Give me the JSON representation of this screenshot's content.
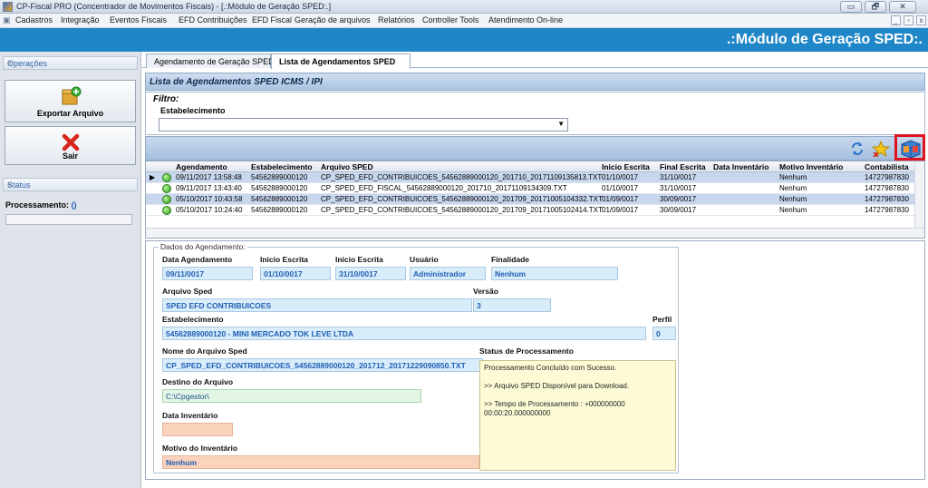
{
  "window": {
    "title": "CP-Fiscal PRO (Concentrador de Movimentos Fiscais) - [.:Módulo de Geração SPED:.]",
    "controls": [
      "▭",
      "🗗",
      "✕"
    ],
    "mdi_controls": [
      "_",
      "▫",
      "x"
    ]
  },
  "menu": [
    "Cadastros",
    "Integração",
    "Eventos Fiscais",
    "EFD Contribuições",
    "EFD Fiscal",
    "Geração de arquivos",
    "Relatórios",
    "Controller Tools",
    "Atendimento On-line"
  ],
  "banner": ".:Módulo de Geração SPED:.",
  "sidebar": {
    "operacoes_title": "Operações",
    "export_label": "Exportar Arquivo",
    "sair_label": "Sair",
    "status_title": "Status",
    "processamento_label": "Processamento:",
    "processamento_value": "()"
  },
  "tabs": [
    "Agendamento de Geração SPED",
    "Lista de Agendamentos SPED"
  ],
  "list": {
    "header": "Lista de Agendamentos SPED ICMS / IPI",
    "filtro_label": "Filtro:",
    "estabelecimento_label": "Estabelecimento",
    "estabelecimento_value": ""
  },
  "grid": {
    "columns": [
      "Agendamento",
      "Estabelecimento",
      "Arquivo SPED",
      "Inicio Escrita",
      "Final Escrita",
      "Data Inventário",
      "Motivo Inventário",
      "Contabilista"
    ],
    "rows": [
      [
        "09/11/2017 13:58:48",
        "54562889000120",
        "CP_SPED_EFD_CONTRIBUICOES_54562889000120_201710_20171109135813.TXT",
        "01/10/0017",
        "31/10/0017",
        "",
        "Nenhum",
        "14727987830"
      ],
      [
        "09/11/2017 13:43:40",
        "54562889000120",
        "CP_SPED_EFD_FISCAL_54562889000120_201710_20171109134309.TXT",
        "01/10/0017",
        "31/10/0017",
        "",
        "Nenhum",
        "14727987830"
      ],
      [
        "05/10/2017 10:43:58",
        "54562889000120",
        "CP_SPED_EFD_CONTRIBUICOES_54562889000120_201709_20171005104332.TXT",
        "01/09/0017",
        "30/09/0017",
        "",
        "Nenhum",
        "14727987830"
      ],
      [
        "05/10/2017 10:24:40",
        "54562889000120",
        "CP_SPED_EFD_CONTRIBUICOES_54562889000120_201709_20171005102414.TXT",
        "01/09/0017",
        "30/09/0017",
        "",
        "Nenhum",
        "14727987830"
      ]
    ]
  },
  "details": {
    "group_title": "Dados do Agendamento:",
    "data_agendamento_label": "Data Agendamento",
    "data_agendamento": "09/11/0017",
    "inicio_escrita_label": "Inicio Escrita",
    "inicio_escrita": "01/10/0017",
    "final_escrita_label": "Inicio Escrita",
    "final_escrita": "31/10/0017",
    "usuario_label": "Usuário",
    "usuario": "Administrador",
    "finalidade_label": "Finalidade",
    "finalidade": "Nenhum",
    "arquivo_sped_label": "Arquivo Sped",
    "arquivo_sped": "SPED EFD CONTRIBUICOES",
    "versao_label": "Versão",
    "versao": "3",
    "estabelecimento_label": "Estabelecimento",
    "estabelecimento": "54562889000120 - MINI MERCADO TOK LEVE LTDA",
    "perfil_label": "Perfil",
    "perfil": "0",
    "nome_arquivo_label": "Nome do Arquivo Sped",
    "nome_arquivo": "CP_SPED_EFD_CONTRIBUICOES_54562889000120_201712_20171229090850.TXT",
    "destino_label": "Destino do Arquivo",
    "destino": "C:\\Cpgestor\\",
    "data_inventario_label": "Data Inventário",
    "data_inventario": "",
    "motivo_label": "Motivo do Inventário",
    "motivo": "Nenhum",
    "status_label": "Status de Processamento",
    "status_text": "Processamento Concluído com Sucesso.\n\n>> Arquivo SPED Disponível para Download.\n\n>> Tempo de Processamento : +000000000 00:00:20.000000000"
  },
  "colors": {
    "banner": "#1f86c8",
    "highlight": "#e0141e",
    "link": "#1f5fb5"
  }
}
